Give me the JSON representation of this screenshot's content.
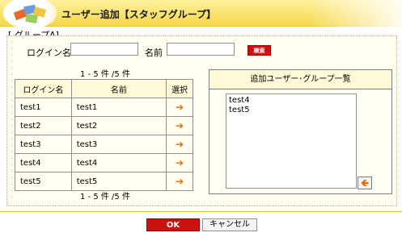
{
  "header": {
    "title": "ユーザー追加【スタッフグループ】"
  },
  "section": {
    "label": "[ グループA]"
  },
  "search": {
    "login_label": "ログイン名",
    "login_value": "",
    "name_label": "名前",
    "name_value": "",
    "button_label": "検索"
  },
  "pagination": {
    "top": "1 - 5 件 /5 件",
    "bottom": "1 - 5 件 /5 件"
  },
  "table": {
    "headers": [
      "ログイン名",
      "名前",
      "選択"
    ],
    "rows": [
      {
        "login": "test1",
        "name": "test1"
      },
      {
        "login": "test2",
        "name": "test2"
      },
      {
        "login": "test3",
        "name": "test3"
      },
      {
        "login": "test4",
        "name": "test4"
      },
      {
        "login": "test5",
        "name": "test5"
      }
    ]
  },
  "added": {
    "title": "追加ユーザー･グループ一覧",
    "items": [
      "test4",
      "test5"
    ]
  },
  "actions": {
    "ok_label": "OK",
    "cancel_label": "キャンセル"
  },
  "icons": {
    "select_arrow": "arrow-right-icon",
    "remove_arrow": "arrow-left-icon"
  },
  "colors": {
    "accent_red": "#cc1111",
    "header_yellow": "#f6d84a",
    "arrow_orange": "#e36a00"
  }
}
